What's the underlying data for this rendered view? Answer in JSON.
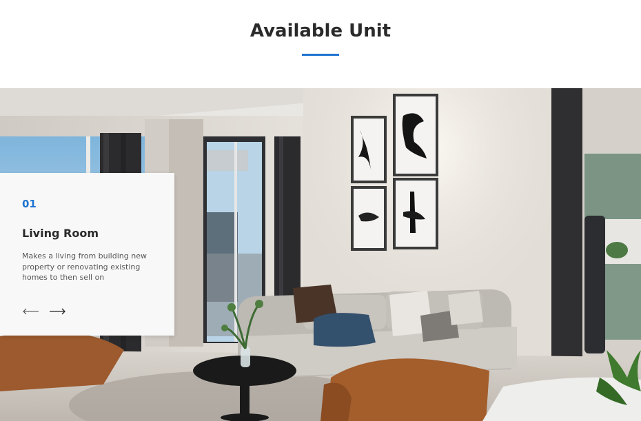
{
  "section": {
    "title": "Available Unit"
  },
  "slide": {
    "number": "01",
    "title": "Living Room",
    "description": "Makes a living from building new property or renovating existing homes to then sell on"
  },
  "nav": {
    "prev_icon": "arrow-left-icon",
    "next_icon": "arrow-right-icon"
  },
  "colors": {
    "accent": "#1f74d0",
    "heading": "#2a2a2a",
    "body_text": "#555555",
    "card_bg": "#f8f8f8"
  }
}
